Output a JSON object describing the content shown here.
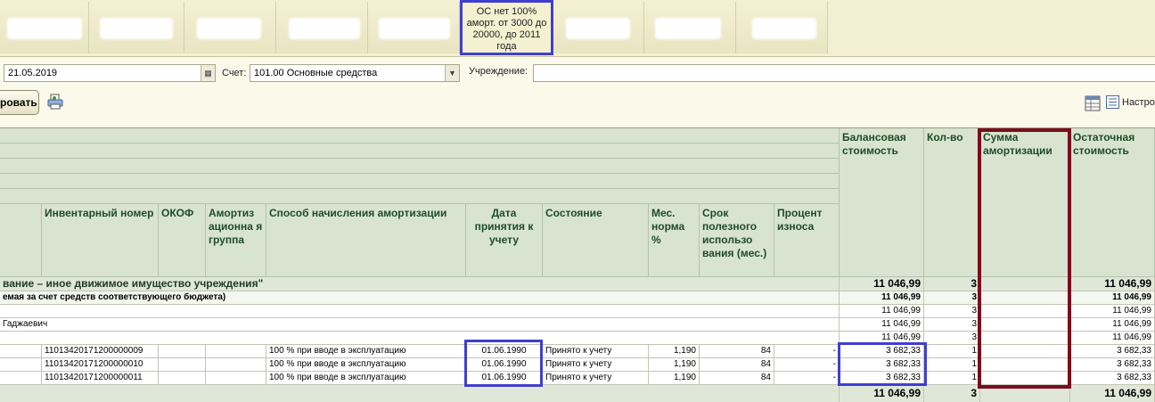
{
  "tab_bar": {
    "active_tab_label": "ОС нет 100% аморт. от 3000 до 20000, до 2011 года"
  },
  "filters": {
    "date_value": "21.05.2019",
    "account_label": "Счет:",
    "account_value": "101.00 Основные средства",
    "institution_label": "Учреждение:",
    "institution_value": ""
  },
  "toolbar": {
    "generate_label": "ровать",
    "settings_label": "Настро"
  },
  "table": {
    "headers": {
      "inventory_number": "Инвентарный номер",
      "okof": "ОКОФ",
      "amort_group": "Амортиз ационна я группа",
      "method": "Способ начисления амортизации",
      "date_accepted": "Дата принятия к учету",
      "state": "Состояние",
      "monthly_rate": "Мес. норма %",
      "useful_life": "Срок полезного использо вания (мес.)",
      "wear_percent": "Процент износа",
      "balance_value": "Балансовая стоимость",
      "quantity": "Кол-во",
      "amortization_sum": "Сумма амортизации",
      "residual_value": "Остаточная стоимость"
    },
    "group_rows": [
      {
        "text": "вание – иное движимое имущество учреждения\"",
        "balance": "11 046,99",
        "qty": "3",
        "residual": "11 046,99"
      },
      {
        "text": "емая за счет средств соответствующего бюджета)",
        "balance": "11 046,99",
        "qty": "3",
        "residual": "11 046,99"
      },
      {
        "text": "",
        "balance": "11 046,99",
        "qty": "3",
        "residual": "11 046,99"
      },
      {
        "text": "Гаджаевич",
        "balance": "11 046,99",
        "qty": "3",
        "residual": "11 046,99"
      },
      {
        "text": "",
        "balance": "11 046,99",
        "qty": "3",
        "residual": "11 046,99"
      }
    ],
    "detail_rows": [
      {
        "inv": "11013420171200000009",
        "method": "100 % при вводе в эксплуатацию",
        "date": "01.06.1990",
        "state": "Принято к учету",
        "rate": "1,190",
        "life": "84",
        "wear": "-",
        "balance": "3 682,33",
        "qty": "1",
        "residual": "3 682,33"
      },
      {
        "inv": "11013420171200000010",
        "method": "100 % при вводе в эксплуатацию",
        "date": "01.06.1990",
        "state": "Принято к учету",
        "rate": "1,190",
        "life": "84",
        "wear": "-",
        "balance": "3 682,33",
        "qty": "1",
        "residual": "3 682,33"
      },
      {
        "inv": "11013420171200000011",
        "method": "100 % при вводе в эксплуатацию",
        "date": "01.06.1990",
        "state": "Принято к учету",
        "rate": "1,190",
        "life": "84",
        "wear": "-",
        "balance": "3 682,33",
        "qty": "1",
        "residual": "3 682,33"
      }
    ],
    "total_row": {
      "balance": "11 046,99",
      "qty": "3",
      "residual": "11 046,99"
    }
  },
  "icons": {
    "date_picker": "calendar-icon",
    "account_dropdown": "chevron-down-icon",
    "print": "printer-icon",
    "layout": "table-layout-icon",
    "settings": "settings-list-icon"
  },
  "colors": {
    "header_bg": "#d8e4d0",
    "header_text": "#1f4b2a",
    "highlight_blue": "#3f3fd0",
    "highlight_red": "#7a0d1c"
  }
}
